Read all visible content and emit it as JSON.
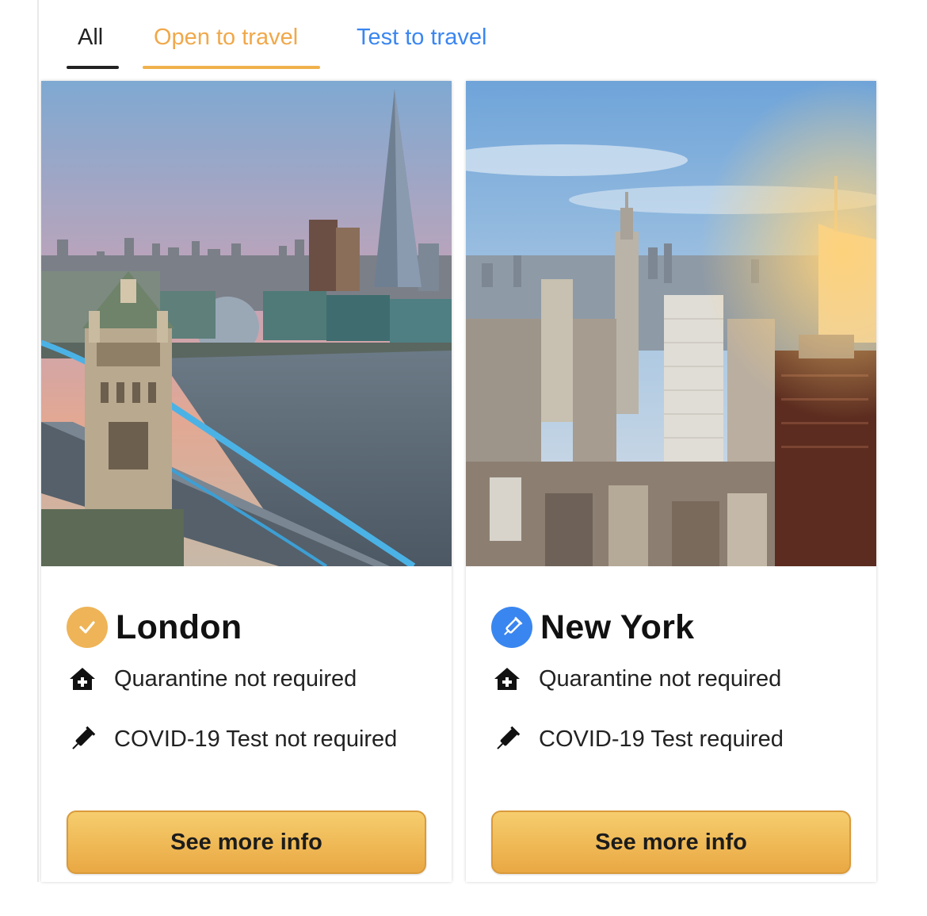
{
  "tabs": [
    {
      "label": "All",
      "state": "selected"
    },
    {
      "label": "Open to travel",
      "state": "active-filter"
    },
    {
      "label": "Test to travel",
      "state": "default"
    }
  ],
  "cards": [
    {
      "city": "London",
      "status_icon": "check-circle-icon",
      "status_color": "#eeb457",
      "quarantine": {
        "icon": "house-medical-icon",
        "text": "Quarantine not required"
      },
      "test": {
        "icon": "syringe-icon",
        "text": "COVID-19 Test not required"
      },
      "button_label": "See more info",
      "photo": "london-tower-bridge-photo"
    },
    {
      "city": "New York",
      "status_icon": "syringe-circle-icon",
      "status_color": "#3a86f0",
      "quarantine": {
        "icon": "house-medical-icon",
        "text": "Quarantine not required"
      },
      "test": {
        "icon": "syringe-icon",
        "text": "COVID-19 Test required"
      },
      "button_label": "See more info",
      "photo": "new-york-skyline-photo"
    }
  ],
  "colors": {
    "accent_orange": "#f0a84a",
    "accent_blue": "#3a86f0",
    "button_gradient_top": "#f6cd6d",
    "button_gradient_bottom": "#e9a843"
  }
}
